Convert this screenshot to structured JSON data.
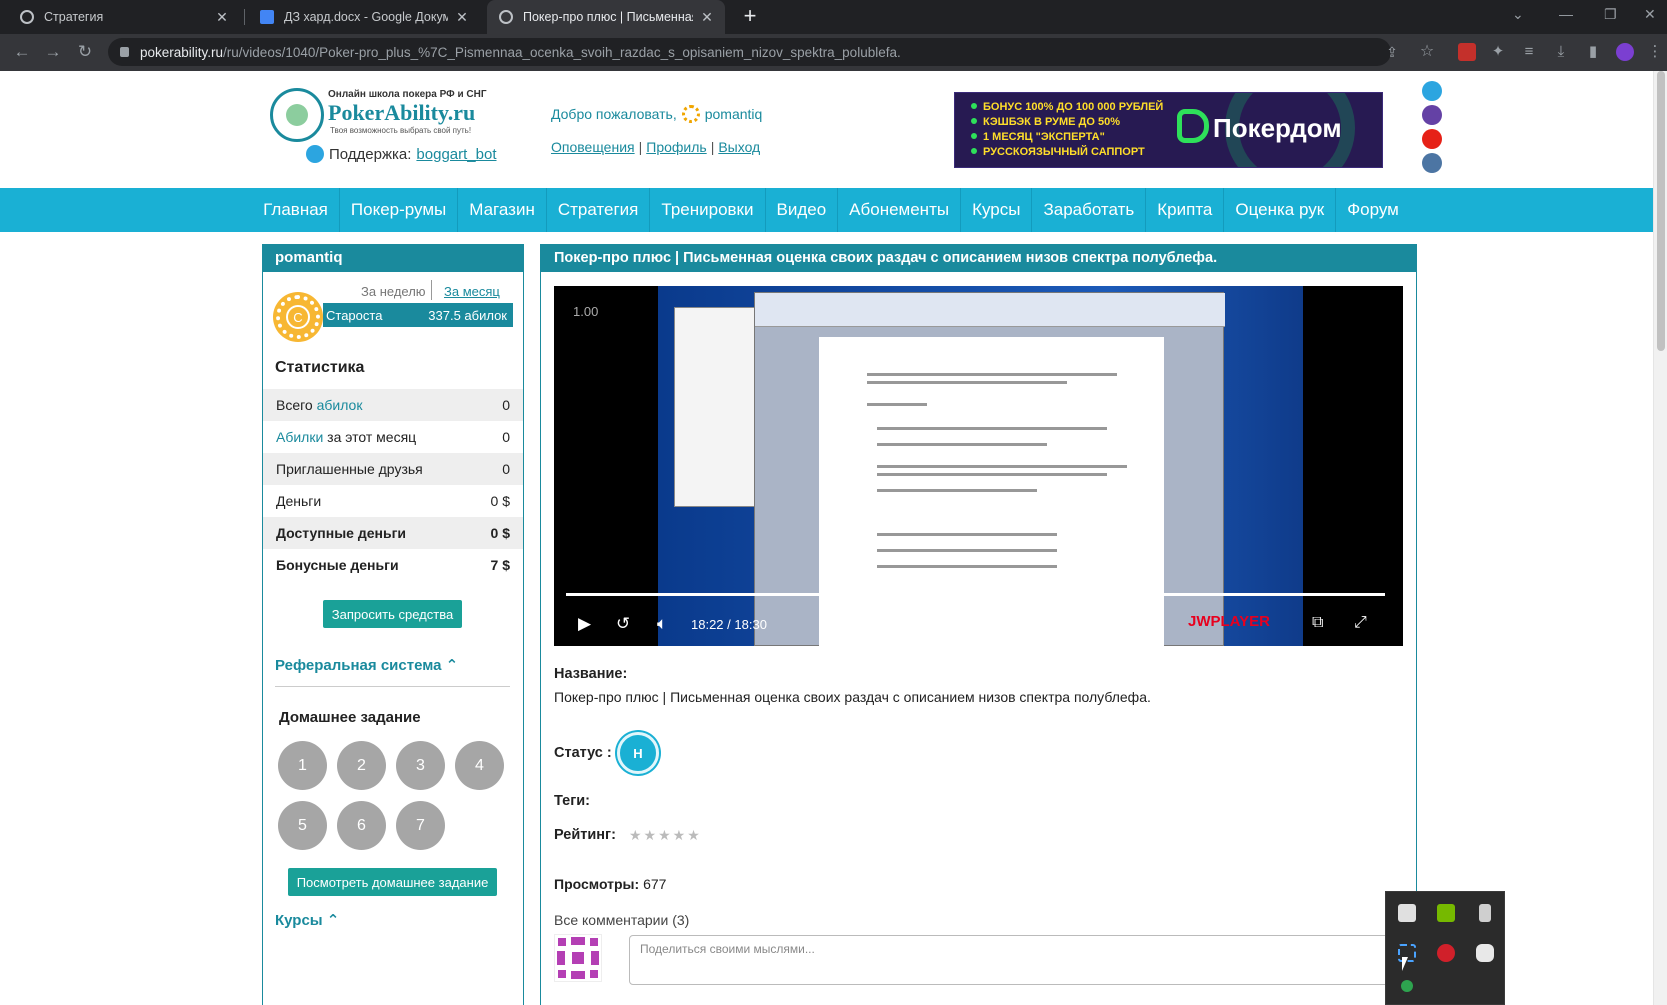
{
  "browser": {
    "tabs": [
      {
        "title": "Стратегия",
        "icon": "site-globe-icon"
      },
      {
        "title": "ДЗ хард.docx - Google Докумен",
        "icon": "google-docs-icon"
      },
      {
        "title": "Покер-про плюс | Письменная",
        "icon": "site-globe-icon",
        "active": true
      }
    ],
    "new_tab": "+",
    "url_host": "pokerability.ru",
    "url_path": "/ru/videos/1040/Poker-pro_plus_%7C_Pismennaa_ocenka_svoih_razdac_s_opisaniem_nizov_spektra_polublefa."
  },
  "header": {
    "logo_tagline_top": "Онлайн школа покера РФ и СНГ",
    "logo_name": "PokerAbility.ru",
    "logo_tagline_bottom": "Твоя возможность выбрать свой путь!",
    "support_label": "Поддержка:",
    "support_link": "boggart_bot",
    "welcome": "Добро пожаловать,",
    "username": "pomantiq",
    "links": [
      "Оповещения",
      "Профиль",
      "Выход"
    ],
    "banner_lines": [
      "БОНУС 100% ДО 100 000 РУБЛЕЙ",
      "КЭШБЭК В РУМЕ ДО 50%",
      "1 МЕСЯЦ \"ЭКСПЕРТА\"",
      "РУССКОЯЗЫЧНЫЙ САППОРТ"
    ],
    "banner_brand": "Покердом",
    "social": [
      {
        "name": "telegram",
        "color": "#2ca5e0"
      },
      {
        "name": "twitch",
        "color": "#6441a5"
      },
      {
        "name": "youtube",
        "color": "#e62117"
      },
      {
        "name": "vk",
        "color": "#4c75a3"
      }
    ]
  },
  "nav": [
    "Главная",
    "Покер-румы",
    "Магазин",
    "Стратегия",
    "Тренировки",
    "Видео",
    "Абонементы",
    "Курсы",
    "Заработать",
    "Крипта",
    "Оценка рук",
    "Форум"
  ],
  "sidebar": {
    "title": "pomantiq",
    "period_week": "За неделю",
    "period_month": "За месяц",
    "rank_chip": "С",
    "rank_name": "Староста",
    "rank_value": "337.5 абилок",
    "stats_title": "Статистика",
    "stats": [
      {
        "pre": "Всего ",
        "hl": "абилок",
        "post": "",
        "value": "0"
      },
      {
        "pre": "",
        "hl": "Абилки",
        "post": " за этот месяц",
        "value": "0"
      },
      {
        "pre": "Приглашенные друзья",
        "hl": "",
        "post": "",
        "value": "0"
      },
      {
        "pre": "Деньги",
        "hl": "",
        "post": "",
        "value": "0 $"
      },
      {
        "pre": "Доступные деньги",
        "hl": "",
        "post": "",
        "value": "0 $"
      },
      {
        "pre": "Бонусные деньги",
        "hl": "",
        "post": "",
        "value": "7 $"
      }
    ],
    "request_btn": "Запросить средства",
    "referral": "Реферальная система",
    "homework_title": "Домашнее задание",
    "homework": [
      "1",
      "2",
      "3",
      "4",
      "5",
      "6",
      "7"
    ],
    "view_homework_btn": "Посмотреть домашнее задание",
    "courses": "Курсы"
  },
  "main": {
    "title": "Покер-про плюс | Письменная оценка своих раздач с описанием низов спектра полублефа.",
    "player": {
      "rate": "1.00",
      "time_current": "18:22",
      "time_sep": "/",
      "time_total": "18:30",
      "brand": "JWPLAYER",
      "progress": 0.993
    },
    "name_label": "Название:",
    "name_value": "Покер-про плюс | Письменная оценка своих раздач с описанием низов спектра полублефа.",
    "status_label": "Статус :",
    "status_badge": "Н",
    "tags_label": "Теги:",
    "rating_label": "Рейтинг:",
    "rating_stars": "★★★★★",
    "views_label": "Просмотры:",
    "views_value": "677",
    "comments_label": "Все комментарии (3)",
    "comment_placeholder": "Поделиться своими мыслями..."
  }
}
